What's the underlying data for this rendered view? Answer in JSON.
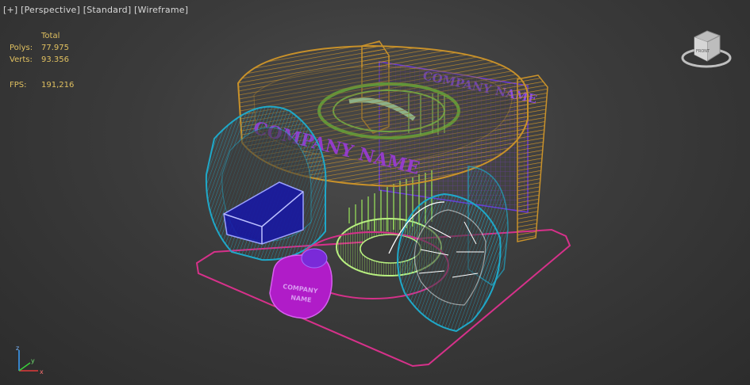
{
  "viewport": {
    "label_plus": "[+]",
    "label_view": "[Perspective]",
    "label_shading": "[Standard]",
    "label_mode": "[Wireframe]"
  },
  "stats": {
    "header": "Total",
    "polys_label": "Polys:",
    "polys_value": "77.975",
    "verts_label": "Verts:",
    "verts_value": "93.356",
    "fps_label": "FPS:",
    "fps_value": "191,216"
  },
  "scene_text": {
    "company_name_top": "COMPANY NAME",
    "company_name_ring": "COMPANY NAME",
    "company_name_counter_line1": "COMPANY",
    "company_name_counter_line2": "NAME"
  },
  "viewcube": {
    "face_label": "FRONT"
  },
  "axis": {
    "x": "x",
    "y": "y",
    "z": "z"
  },
  "colors": {
    "orange": "#c8912a",
    "cyan": "#1fa8c8",
    "purple": "#7f3bd8",
    "green": "#8be04a",
    "magenta": "#d6318a",
    "blue": "#1a1ab0",
    "violet": "#b01cc8"
  }
}
